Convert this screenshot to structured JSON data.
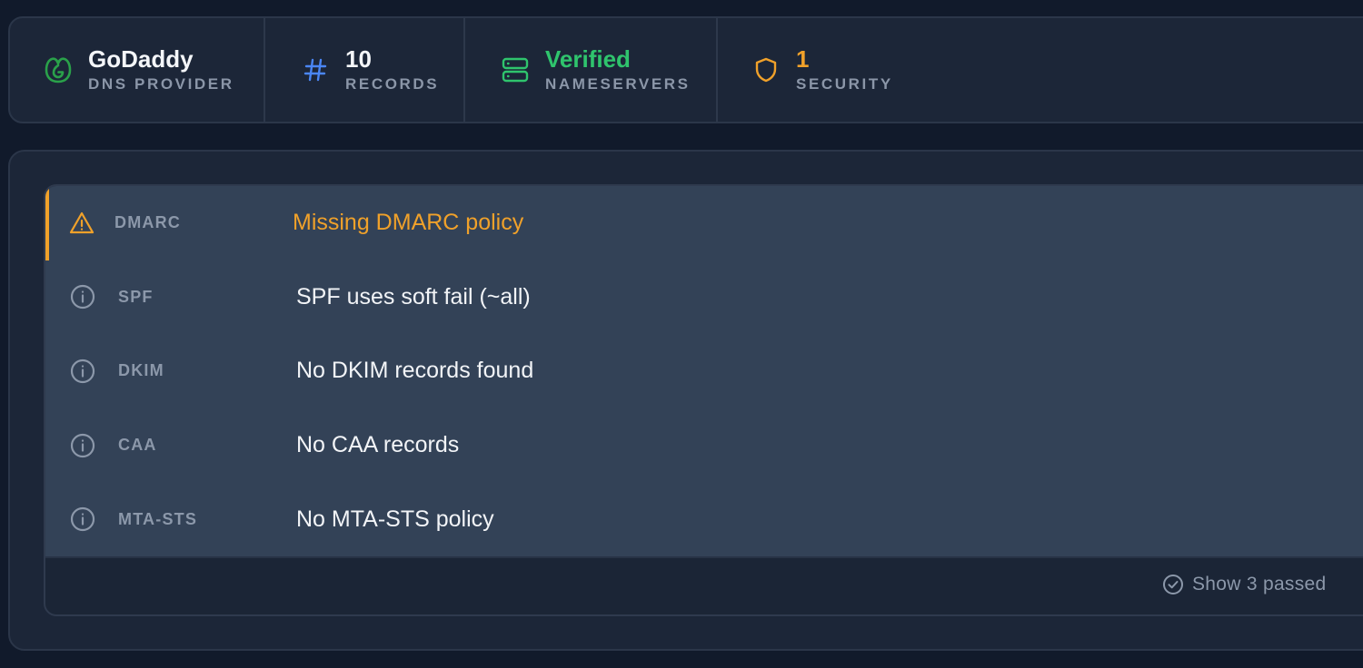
{
  "stats": [
    {
      "value": "GoDaddy",
      "label": "DNS PROVIDER",
      "icon": "godaddy-logo-icon",
      "value_color": "#f4f6f9"
    },
    {
      "value": "10",
      "label": "RECORDS",
      "icon": "hash-icon",
      "value_color": "#f4f6f9"
    },
    {
      "value": "Verified",
      "label": "NAMESERVERS",
      "icon": "server-icon",
      "value_color": "#2fc46d"
    },
    {
      "value": "1",
      "label": "SECURITY",
      "icon": "shield-icon",
      "value_color": "#f0a12a"
    }
  ],
  "checks": [
    {
      "name": "DMARC",
      "message": "Missing DMARC policy",
      "status": "warning",
      "icon": "warning-triangle-icon"
    },
    {
      "name": "SPF",
      "message": "SPF uses soft fail (~all)",
      "status": "info",
      "icon": "info-circle-icon"
    },
    {
      "name": "DKIM",
      "message": "No DKIM records found",
      "status": "info",
      "icon": "info-circle-icon"
    },
    {
      "name": "CAA",
      "message": "No CAA records",
      "status": "info",
      "icon": "info-circle-icon"
    },
    {
      "name": "MTA-STS",
      "message": "No MTA-STS policy",
      "status": "info",
      "icon": "info-circle-icon"
    }
  ],
  "footer": {
    "show_passed_label": "Show 3 passed",
    "icon": "check-circle-icon"
  },
  "colors": {
    "background": "#111a2b",
    "panel": "#1c2638",
    "list_background": "#334257",
    "warning": "#f0a12a",
    "success": "#2fc46d",
    "accent_blue": "#4a86f5",
    "muted_text": "#8c98aa"
  }
}
